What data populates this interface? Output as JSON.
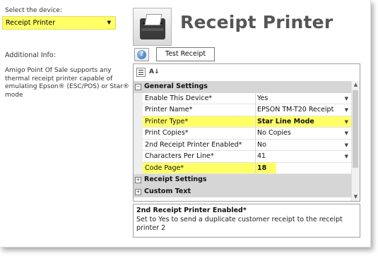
{
  "left": {
    "select_label": "Select the device:",
    "device_value": "Receipt Printer",
    "info_label": "Additional Info:",
    "info_text": "Amigo Point Of Sale supports any thermal receipt printer capable of emulating Epson® (ESC/POS) or Star® mode"
  },
  "header": {
    "title": "Receipt Printer",
    "printer_icon": "receipt-printer-icon"
  },
  "buttons": {
    "help_glyph": "?",
    "test_receipt": "Test Receipt"
  },
  "toolbar": {
    "categorized_icon": "categorized-view-icon",
    "alphabetical_icon": "alphabetical-sort-icon",
    "alphabetical_glyph": "A↓"
  },
  "categories": {
    "general": "General Settings",
    "receipt": "Receipt Settings",
    "custom": "Custom Text"
  },
  "properties": [
    {
      "name": "Enable This Device*",
      "value": "Yes"
    },
    {
      "name": "Printer Name*",
      "value": "EPSON TM-T20 Receipt"
    },
    {
      "name": "Printer Type*",
      "value": "Star Line Mode"
    },
    {
      "name": "Print Copies*",
      "value": "No Copies"
    },
    {
      "name": "2nd Receipt Printer Enabled*",
      "value": "No"
    },
    {
      "name": "Characters Per Line*",
      "value": "41"
    },
    {
      "name": "Code Page*",
      "value": "18"
    }
  ],
  "description": {
    "title": "2nd Receipt Printer Enabled*",
    "text": "Set to Yes to send a duplicate customer receipt to the receipt printer 2"
  },
  "colors": {
    "highlight": "#ffff66",
    "category_bg": "#d6d6d6",
    "title_text": "#555555"
  }
}
